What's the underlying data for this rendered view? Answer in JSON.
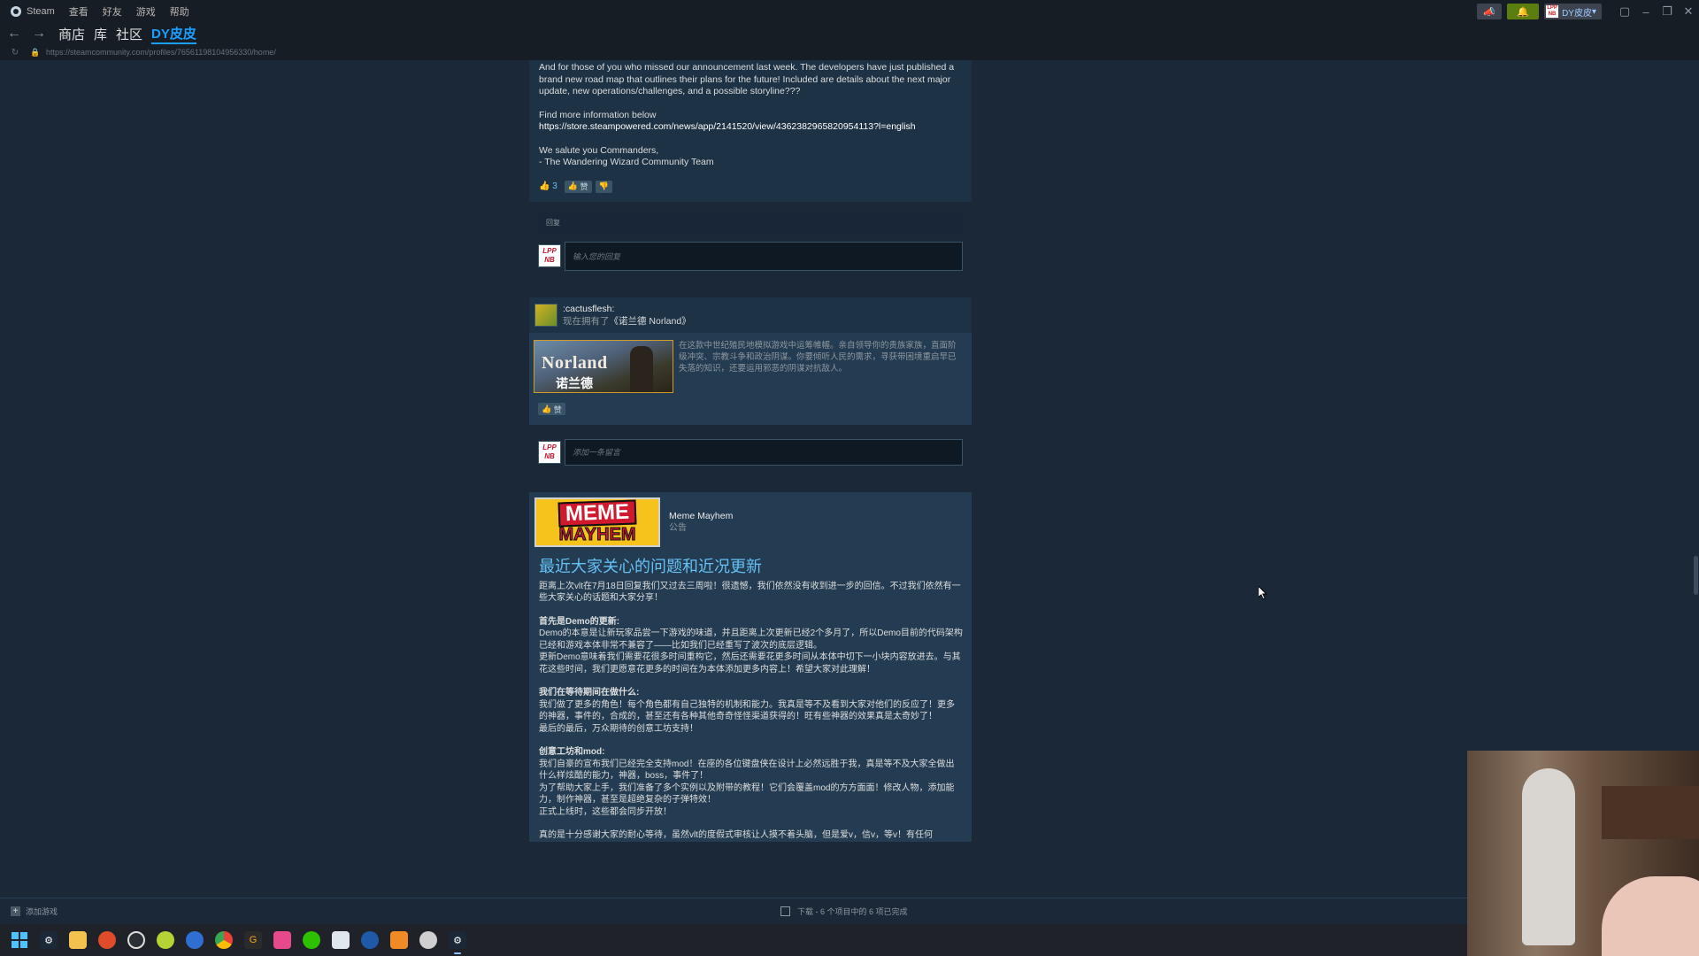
{
  "titlebar": {
    "app_name": "Steam",
    "menu": [
      "查看",
      "好友",
      "游戏",
      "帮助"
    ],
    "user_chip": "DY皮皮",
    "avatar_text": [
      "LPP",
      "NB"
    ]
  },
  "nav": {
    "links": [
      "商店",
      "库",
      "社区"
    ],
    "active": "DY皮皮"
  },
  "url": "https://steamcommunity.com/profiles/76561198104956330/home/",
  "post1": {
    "paragraphs": [
      "And for those of you who missed our announcement last week. The developers have just published a brand new road map that outlines their plans for the future! Included are details about the next major update, new operations/challenges, and a possible storyline???",
      "Find more information below",
      "https://store.steampowered.com/news/app/2141520/view/4362382965820954113?l=english",
      "We salute you Commanders,",
      "- The Wandering Wizard Community Team"
    ],
    "rate_count": "3",
    "rate_up_label": "赞",
    "reply_header": "回复",
    "reply_placeholder": "输入您的回复"
  },
  "activity": {
    "user": ":cactusflesh:",
    "desc_prefix": "现在拥有了",
    "game_name": "《诺兰德 Norland》",
    "capsule_title": "Norland",
    "capsule_cn": "诺兰德",
    "game_desc": "在这款中世纪殖民地模拟游戏中运筹帷幄。亲自领导你的贵族家族，直面阶级冲突、宗教斗争和政治阴谋。你要倾听人民的需求，寻获带困境重启早已失落的知识，还要运用邪恶的阴谋对抗敌人。",
    "rate_up_label": "赞",
    "comment_placeholder": "添加一条留言"
  },
  "news": {
    "logo_line1": "MEME",
    "logo_line2": "MAYHEM",
    "app_name": "Meme Mayhem",
    "type": "公告",
    "title": "最近大家关心的问题和近况更新",
    "paragraphs": [
      [
        "距离上次vlt在7月18日回复我们又过去三周啦！很遗憾，我们依然没有收到进一步的回信。不过我们依然有一些大家关心的话题和大家分享！"
      ],
      [
        "首先是Demo的更新:",
        "Demo的本意是让新玩家品尝一下游戏的味道，并且距离上次更新已经2个多月了，所以Demo目前的代码架构已经和游戏本体非常不兼容了——比如我们已经重写了波次的底层逻辑。",
        "更新Demo意味着我们需要花很多时间重构它，然后还需要花更多时间从本体中切下一小块内容放进去。与其花这些时间，我们更愿意花更多的时间在为本体添加更多内容上！希望大家对此理解！"
      ],
      [
        "我们在等待期间在做什么:",
        "我们做了更多的角色！每个角色都有自己独特的机制和能力。我真是等不及看到大家对他们的反应了！更多的神器，事件的，合成的，甚至还有各种其他奇奇怪怪渠道获得的！旺有些神器的效果真是太奇妙了！",
        "最后的最后，万众期待的创意工坊支持！"
      ],
      [
        "创意工坊和mod:",
        "我们自豪的宣布我们已经完全支持mod！在座的各位键盘侠在设计上必然远胜于我，真是等不及大家全做出什么样炫酷的能力，神器，boss，事件了！",
        "为了帮助大家上手，我们准备了多个实例以及附带的教程！它们会覆盖mod的方方面面！修改人物，添加能力，制作神器，甚至是超绝复杂的子弹特效！",
        "正式上线时，这些都会同步开放！"
      ],
      [
        "真的是十分感谢大家的耐心等待，虽然vlt的度假式审核让人摸不着头脑，但是爱v，信v，等v！有任何"
      ]
    ]
  },
  "statusbar": {
    "add_game": "添加游戏",
    "download": "下载 - 6 个项目中的 6 项已完成"
  },
  "taskbar_icons": [
    "windows-start",
    "steam",
    "file-explorer",
    "app-red",
    "app-clock",
    "app-ball",
    "app-blue",
    "chrome",
    "app-g",
    "app-pink",
    "wechat",
    "app-window",
    "app-blue2",
    "app-orange",
    "app-gear",
    "steam-active"
  ]
}
